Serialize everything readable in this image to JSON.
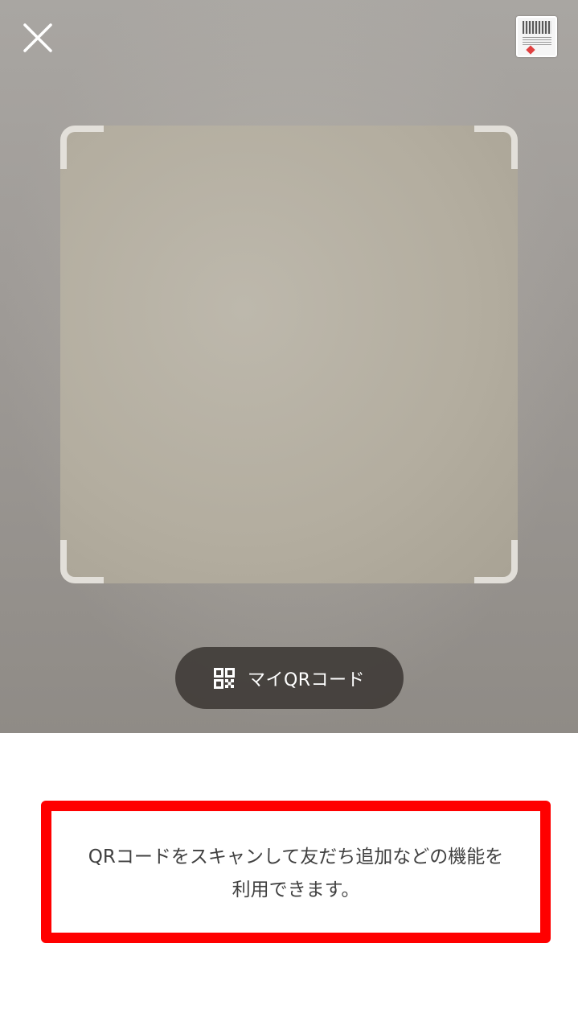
{
  "scanner": {
    "my_qr_button_label": "マイQRコード"
  },
  "info": {
    "line1": "QRコードをスキャンして友だち追加などの機能を",
    "line2": "利用できます。",
    "highlight_color": "#ff0000"
  },
  "icons": {
    "close": "close-icon",
    "gallery": "gallery-thumbnail",
    "qr": "qr-code-icon"
  }
}
